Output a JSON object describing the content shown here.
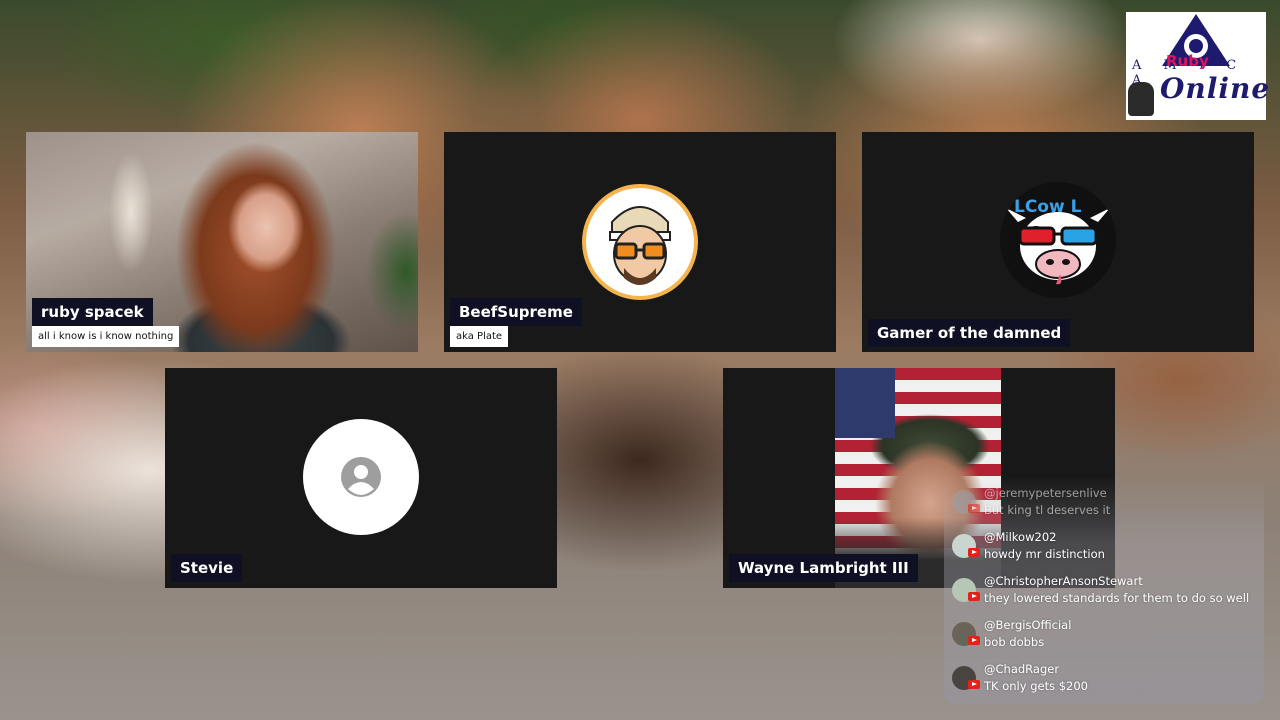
{
  "logo": {
    "letters": "A M I C A",
    "overlay": "Ruby",
    "script": "Online"
  },
  "participants": [
    {
      "name": "ruby spacek",
      "subtitle": "all i know is i know nothing",
      "media": "camera"
    },
    {
      "name": "BeefSupreme",
      "subtitle": "aka Plate",
      "media": "avatar"
    },
    {
      "name": "Gamer of the damned",
      "subtitle": "",
      "media": "avatar",
      "avatar_text": "LCow L"
    },
    {
      "name": "Stevie",
      "subtitle": "",
      "media": "placeholder-avatar"
    },
    {
      "name": "Wayne Lambright III",
      "subtitle": "",
      "media": "camera"
    }
  ],
  "chat": {
    "messages": [
      {
        "user": "@jeremypetersenlive",
        "text": "But king tl deserves it",
        "platform": "youtube"
      },
      {
        "user": "@Milkow202",
        "text": "howdy mr distinction",
        "platform": "youtube"
      },
      {
        "user": "@ChristopherAnsonStewart",
        "text": "they lowered standards for them to do so well",
        "platform": "youtube"
      },
      {
        "user": "@BergisOfficial",
        "text": "bob dobbs",
        "platform": "youtube"
      },
      {
        "user": "@ChadRager",
        "text": "TK only gets $200",
        "platform": "youtube"
      }
    ]
  },
  "colors": {
    "tile_background": "#181818",
    "name_tag_background": "#101025",
    "youtube_red": "#e62117",
    "logo_navy": "#1e1a6e",
    "logo_pink": "#e0115f"
  }
}
